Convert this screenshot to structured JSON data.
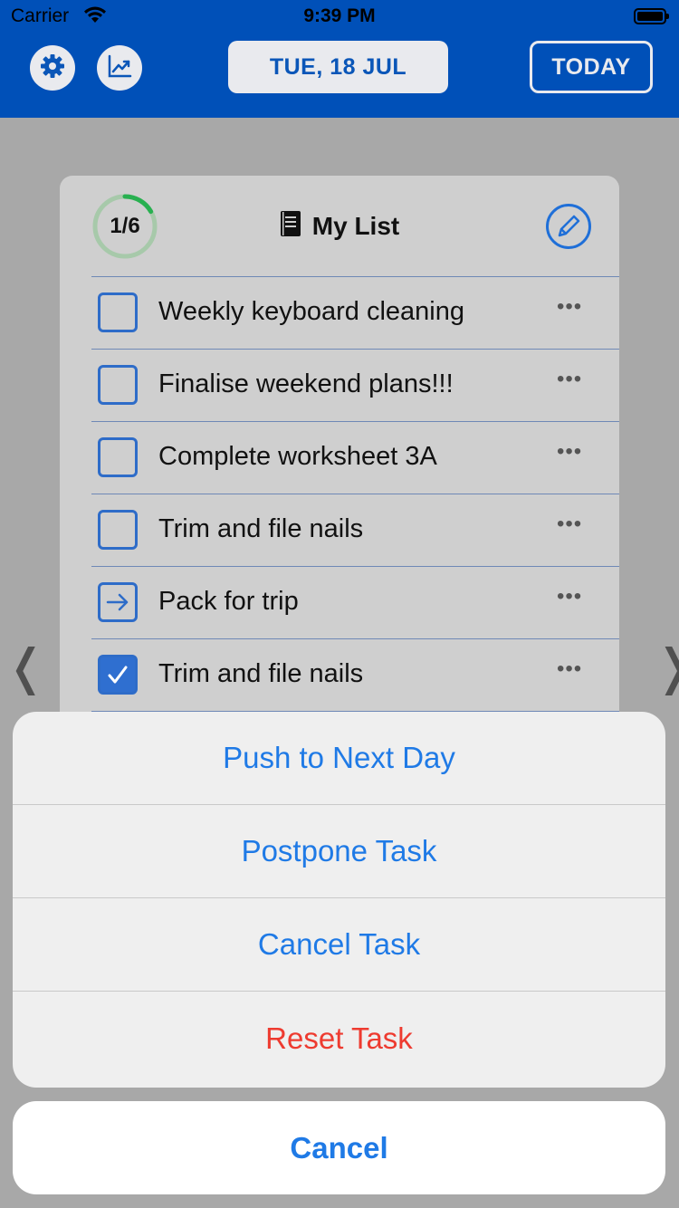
{
  "status_bar": {
    "carrier": "Carrier",
    "time": "9:39 PM"
  },
  "header": {
    "settings_icon": "gear-icon",
    "stats_icon": "chart-icon",
    "date": "TUE, 18 JUL",
    "today_label": "TODAY"
  },
  "list": {
    "progress_text": "1/6",
    "progress_fraction": 0.167,
    "title": "My List",
    "title_icon": "notebook-icon",
    "edit_icon": "pencil-icon",
    "items": [
      {
        "label": "Weekly keyboard cleaning",
        "state": "unchecked",
        "more": "•••"
      },
      {
        "label": "Finalise weekend plans!!!",
        "state": "unchecked",
        "more": "•••"
      },
      {
        "label": "Complete worksheet 3A",
        "state": "unchecked",
        "more": "•••"
      },
      {
        "label": "Trim and file nails",
        "state": "unchecked",
        "more": "•••"
      },
      {
        "label": "Pack for trip",
        "state": "pushed",
        "more": "•••"
      },
      {
        "label": "Trim and file nails",
        "state": "checked",
        "more": "•••"
      }
    ]
  },
  "nav": {
    "prev": "❬",
    "next": "❭"
  },
  "action_sheet": {
    "items": [
      {
        "label": "Push to Next Day"
      },
      {
        "label": "Postpone Task"
      },
      {
        "label": "Cancel Task"
      },
      {
        "label": "Reset Task"
      }
    ],
    "cancel_label": "Cancel"
  },
  "colors": {
    "header_bg": "#0050b8",
    "accent": "#1f7ae6",
    "destructive": "#ee3b30",
    "progress": "#28b050"
  }
}
